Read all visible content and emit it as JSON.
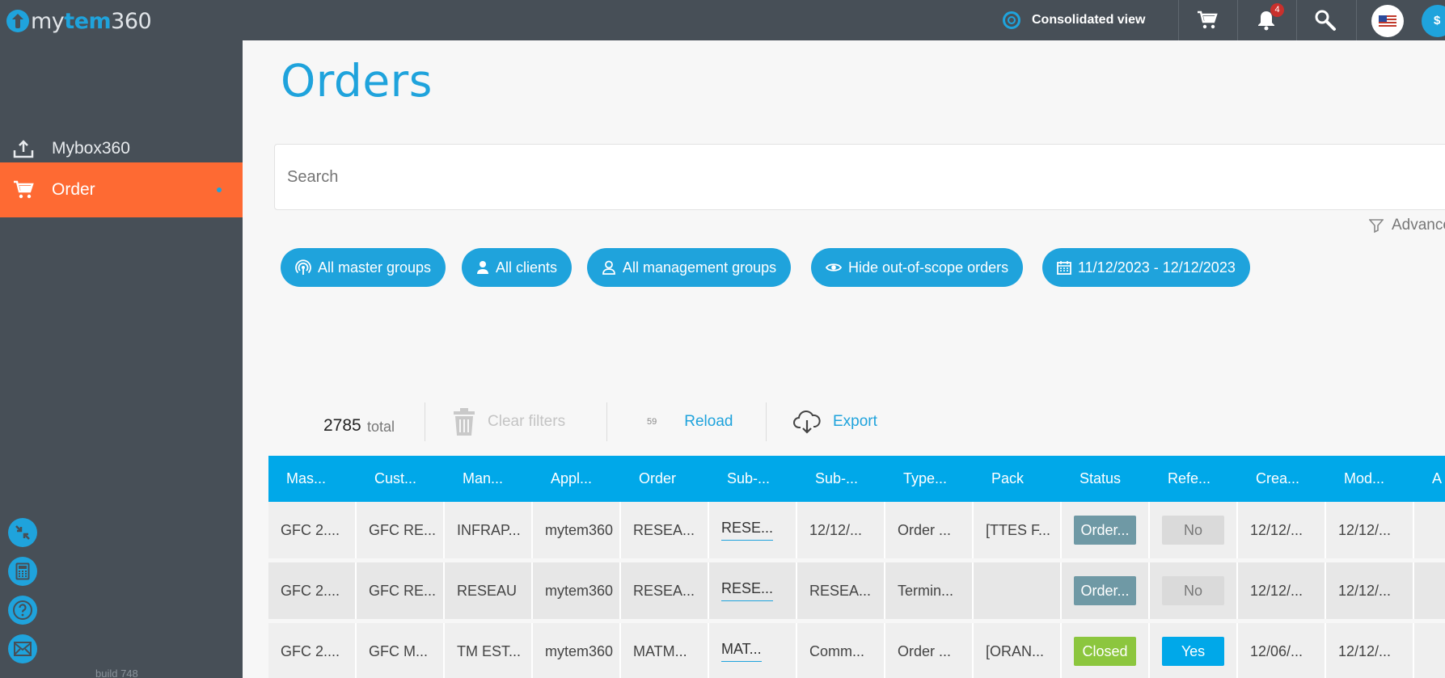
{
  "app": {
    "logo_prefix": "my",
    "logo_brand": "tem",
    "logo_suffix": "360"
  },
  "topbar": {
    "view_label": "Consolidated view",
    "notifications_count": "4",
    "currency_symbol": "$"
  },
  "sidebar": {
    "items": [
      {
        "label": "Mybox360",
        "icon": "upload-tray-icon"
      },
      {
        "label": "Order",
        "icon": "cart-icon",
        "active": true
      }
    ],
    "tools": [
      "collapse-icon",
      "calculator-icon",
      "help-icon",
      "mail-icon"
    ],
    "build": "build 748"
  },
  "page": {
    "title": "Orders",
    "search_placeholder": "Search",
    "advanced_label": "Advanced"
  },
  "filters": [
    {
      "label": "All master groups",
      "icon": "broadcast-icon"
    },
    {
      "label": "All clients",
      "icon": "user-icon"
    },
    {
      "label": "All management groups",
      "icon": "user-outline-icon"
    },
    {
      "label": "Hide out-of-scope orders",
      "icon": "eye-icon"
    },
    {
      "label": "11/12/2023 - 12/12/2023",
      "icon": "calendar-icon"
    }
  ],
  "toolbar": {
    "total_count": "2785",
    "total_label": "total",
    "clear_filters": "Clear filters",
    "reload_count": "59",
    "reload": "Reload",
    "export": "Export"
  },
  "table": {
    "columns": [
      "Mas...",
      "Cust...",
      "Man...",
      "Appl...",
      "Order",
      "Sub-...",
      "Sub-...",
      "Type...",
      "Pack",
      "Status",
      "Refe...",
      "Crea...",
      "Mod...",
      "A"
    ],
    "rows": [
      {
        "cells": [
          "GFC 2....",
          "GFC RE...",
          "INFRAP...",
          "mytem360",
          "RESEA...",
          "RESE...",
          "12/12/...",
          "Order ...",
          "[TTES F...",
          "Order...",
          "No",
          "12/12/...",
          "12/12/...",
          ""
        ],
        "status_style": "order",
        "ref_style": "no"
      },
      {
        "cells": [
          "GFC 2....",
          "GFC RE...",
          "RESEAU",
          "mytem360",
          "RESEA...",
          "RESE...",
          "RESEA...",
          "Termin...",
          "",
          "Order...",
          "No",
          "12/12/...",
          "12/12/...",
          ""
        ],
        "status_style": "order",
        "ref_style": "no"
      },
      {
        "cells": [
          "GFC 2....",
          "GFC M...",
          "TM EST...",
          "mytem360",
          "MATM...",
          "MAT...",
          "Comm...",
          "Order ...",
          "[ORAN...",
          "Closed",
          "Yes",
          "12/06/...",
          "12/12/...",
          ""
        ],
        "status_style": "closed",
        "ref_style": "yes"
      }
    ]
  },
  "colors": {
    "accent": "#1fa3dc",
    "active_nav": "#fe6a33",
    "sidebar": "#474f57",
    "header_row": "#00a8e9"
  }
}
